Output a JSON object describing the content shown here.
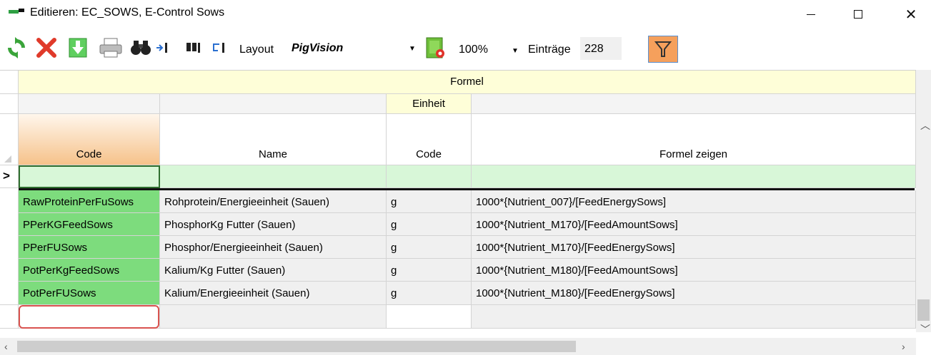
{
  "window": {
    "title": "Editieren: EC_SOWS, E-Control Sows",
    "minimize": "—",
    "maximize": "☐",
    "close": "✕"
  },
  "toolbar": {
    "layout_label": "Layout",
    "layout_value": "PigVision",
    "zoom_value": "100%",
    "entries_label": "Einträge",
    "entries_value": "228",
    "icons": [
      "refresh-icon",
      "delete-icon",
      "download-icon",
      "print-icon",
      "binoculars-icon",
      "goto-icon",
      "find-icon",
      "return-icon",
      "layout-settings-icon",
      "filter-icon"
    ]
  },
  "grid": {
    "group_header": "Formel",
    "subgroup_header": "Einheit",
    "columns": [
      "Code",
      "Name",
      "Code",
      "Formel zeigen"
    ],
    "new_row_marker": ">",
    "rows": [
      {
        "code": "RawProteinPerFuSows",
        "name": "Rohprotein/Energieeinheit (Sauen)",
        "unit": "g",
        "formula": "1000*{Nutrient_007}/[FeedEnergySows]"
      },
      {
        "code": "PPerKGFeedSows",
        "name": "PhosphorKg Futter (Sauen)",
        "unit": "g",
        "formula": "1000*{Nutrient_M170}/[FeedAmountSows]"
      },
      {
        "code": "PPerFUSows",
        "name": "Phosphor/Energieeinheit (Sauen)",
        "unit": "g",
        "formula": "1000*{Nutrient_M170}/[FeedEnergySows]"
      },
      {
        "code": "PotPerKgFeedSows",
        "name": "Kalium/Kg Futter (Sauen)",
        "unit": "g",
        "formula": "1000*{Nutrient_M180}/[FeedAmountSows]"
      },
      {
        "code": "PotPerFUSows",
        "name": "Kalium/Energieeinheit (Sauen)",
        "unit": "g",
        "formula": "1000*{Nutrient_M180}/[FeedEnergySows]"
      }
    ]
  },
  "colors": {
    "accent_filter": "#f5a05c",
    "code_cell": "#7ddc7d",
    "new_row": "#d8f7d8",
    "header_yellow": "#fefed8",
    "highlight": "#d9534f"
  }
}
